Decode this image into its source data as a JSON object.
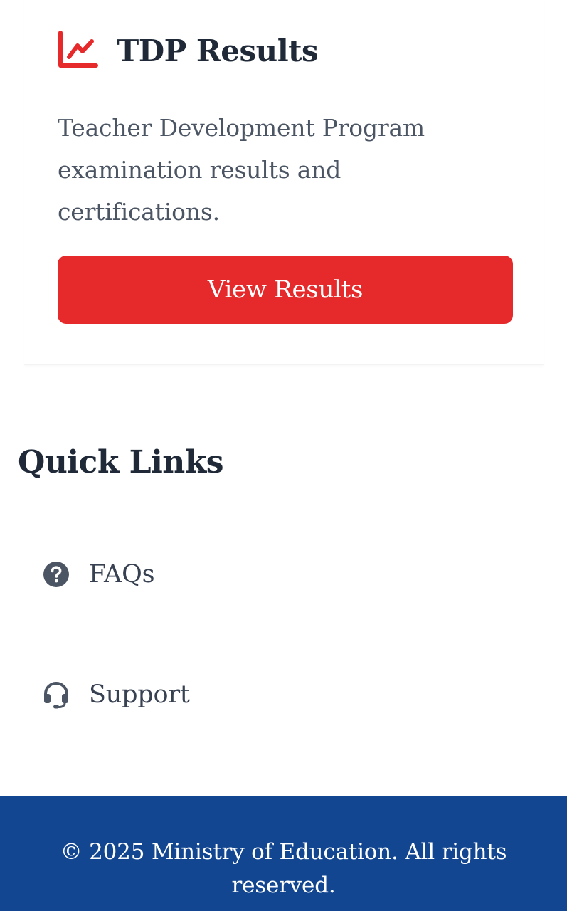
{
  "card": {
    "icon": "chart-line-icon",
    "title": "TDP Results",
    "description": "Teacher Development Program examination results and certifications.",
    "button_label": "View Results"
  },
  "quick_links": {
    "title": "Quick Links",
    "items": [
      {
        "icon": "question-circle-icon",
        "label": "FAQs"
      },
      {
        "icon": "headset-icon",
        "label": "Support"
      }
    ]
  },
  "footer": {
    "copyright": "© 2025 Ministry of Education. All rights reserved."
  },
  "colors": {
    "accent_red": "#e62a2b",
    "footer_blue": "#134690",
    "heading": "#1f2937",
    "body_text": "#4b5563",
    "icon_gray": "#4b5563"
  }
}
